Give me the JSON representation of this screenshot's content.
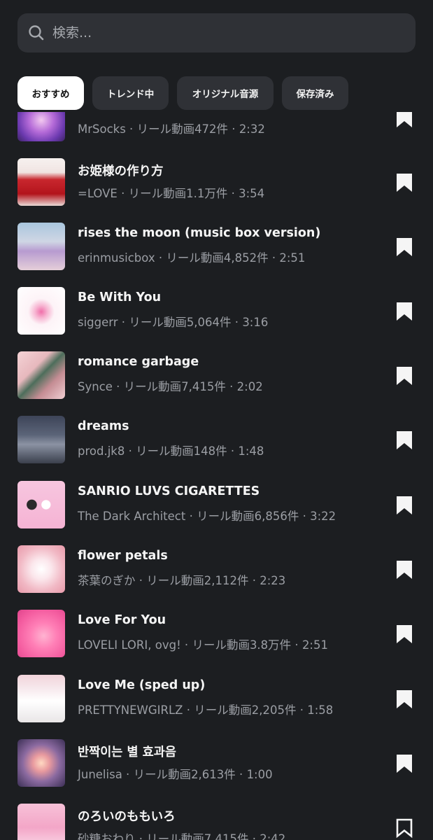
{
  "search": {
    "placeholder": "検索..."
  },
  "tabs": [
    {
      "label": "おすすめ",
      "active": true
    },
    {
      "label": "トレンド中",
      "active": false
    },
    {
      "label": "オリジナル音源",
      "active": false
    },
    {
      "label": "保存済み",
      "active": false
    }
  ],
  "tracks": [
    {
      "title": "",
      "artist": "MrSocks",
      "reels": "472件",
      "duration": "2:32",
      "saved": true
    },
    {
      "title": "お姫様の作り方",
      "artist": "=LOVE",
      "reels": "1.1万件",
      "duration": "3:54",
      "saved": true
    },
    {
      "title": "rises the moon (music box version)",
      "artist": "erinmusicbox",
      "reels": "4,852件",
      "duration": "2:51",
      "saved": true
    },
    {
      "title": "Be With You",
      "artist": "siggerr",
      "reels": "5,064件",
      "duration": "3:16",
      "saved": true
    },
    {
      "title": "romance garbage",
      "artist": "Synce",
      "reels": "7,415件",
      "duration": "2:02",
      "saved": true
    },
    {
      "title": "dreams",
      "artist": "prod.jk8",
      "reels": "148件",
      "duration": "1:48",
      "saved": true
    },
    {
      "title": "SANRIO LUVS CIGARETTES",
      "artist": "The Dark Architect",
      "reels": "6,856件",
      "duration": "3:22",
      "saved": true
    },
    {
      "title": "flower petals",
      "artist": "茶葉のぎか",
      "reels": "2,112件",
      "duration": "2:23",
      "saved": true
    },
    {
      "title": "Love For You",
      "artist": "LOVELI LORI, ovg!",
      "reels": "3.8万件",
      "duration": "2:51",
      "saved": true
    },
    {
      "title": "Love Me (sped up)",
      "artist": "PRETTYNEWGIRLZ",
      "reels": "2,205件",
      "duration": "1:58",
      "saved": true
    },
    {
      "title": "반짝이는 별 효과음",
      "artist": "Junelisa",
      "reels": "2,613件",
      "duration": "1:00",
      "saved": true
    },
    {
      "title": "のろいのももいろ",
      "artist": "砂糖おわり",
      "reels": "7,415件",
      "duration": "2:42",
      "saved": false
    }
  ],
  "meta_prefix": "リール動画",
  "separator": " · ",
  "colors": {
    "background": "#1c1e21",
    "surface": "#2f3136",
    "text_primary": "#f5f5f5",
    "text_secondary": "#9b9ea4",
    "tab_active_bg": "#ffffff"
  },
  "icons": {
    "search": "search-icon",
    "saved": "bookmark-filled-icon",
    "unsaved": "bookmark-outline-icon"
  }
}
